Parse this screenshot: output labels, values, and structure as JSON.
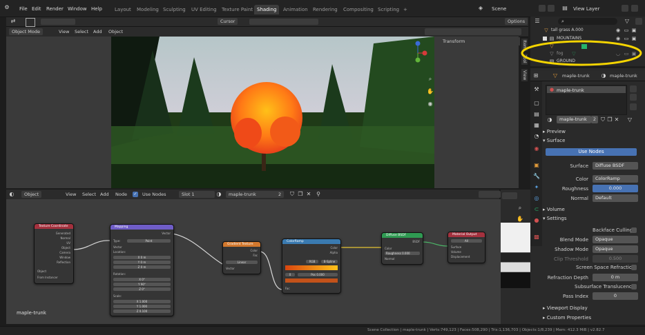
{
  "colors": {
    "accent": "#4772b3",
    "highlight_circle": "#f4d400",
    "node_input": "#a4313e",
    "node_vector": "#6f5dc7",
    "node_texture": "#d2782d",
    "node_converter": "#3a7ab0",
    "node_shader": "#2f9a52",
    "node_output": "#a4313e"
  },
  "topbar": {
    "menu": [
      "File",
      "Edit",
      "Render",
      "Window",
      "Help"
    ],
    "workspaces": [
      "Layout",
      "Modeling",
      "Sculpting",
      "UV Editing",
      "Texture Paint",
      "Shading",
      "Animation",
      "Rendering",
      "Compositing",
      "Scripting"
    ],
    "active_workspace": "Shading",
    "add_tab": "+",
    "scene": "Scene",
    "view_layer": "View Layer"
  },
  "viewport": {
    "mode": "Object Mode",
    "menus": [
      "View",
      "Select",
      "Add",
      "Object"
    ],
    "orientation": "Cursor",
    "options": "Options",
    "transform_panel": "Transform",
    "side_tabs": [
      "Item",
      "Tool",
      "View"
    ]
  },
  "outliner": {
    "search_placeholder": "",
    "items": [
      {
        "name": "tall grass A.000",
        "icon": "object-icon"
      },
      {
        "name": "MOUNTAINS",
        "icon": "collection-icon"
      },
      {
        "name": "",
        "icon": "object-icon"
      },
      {
        "name": "fog",
        "icon": "object-icon"
      },
      {
        "name": "GROUND",
        "icon": "collection-icon"
      }
    ]
  },
  "properties": {
    "object_name": "maple-trunk",
    "material_name": "maple-trunk",
    "slot_item": "maple-trunk",
    "users": "2",
    "sections": {
      "preview": "Preview",
      "surface": "Surface",
      "volume": "Volume",
      "settings": "Settings",
      "viewport_display": "Viewport Display",
      "custom_properties": "Custom Properties"
    },
    "use_nodes": "Use Nodes",
    "surface": {
      "label": "Surface",
      "value": "Diffuse BSDF"
    },
    "color": {
      "label": "Color",
      "value": "ColorRamp"
    },
    "roughness": {
      "label": "Roughness",
      "value": "0.000"
    },
    "normal": {
      "label": "Normal",
      "value": "Default"
    },
    "backface_culling": "Backface Culling",
    "blend_mode": {
      "label": "Blend Mode",
      "value": "Opaque"
    },
    "shadow_mode": {
      "label": "Shadow Mode",
      "value": "Opaque"
    },
    "clip_threshold": {
      "label": "Clip Threshold",
      "value": "0.500"
    },
    "screen_space_refraction": "Screen Space Refraction",
    "refraction_depth": {
      "label": "Refraction Depth",
      "value": "0 m"
    },
    "subsurface_translucency": "Subsurface Translucency",
    "pass_index": {
      "label": "Pass Index",
      "value": "0"
    }
  },
  "node_editor": {
    "type": "Object",
    "menus": [
      "View",
      "Select",
      "Add",
      "Node"
    ],
    "use_nodes": "Use Nodes",
    "slot": "Slot 1",
    "material": "maple-trunk",
    "users": "2",
    "label": "maple-trunk",
    "nodes": {
      "texcoord": {
        "title": "Texture Coordinate",
        "outputs": [
          "Generated",
          "Normal",
          "UV",
          "Object",
          "Camera",
          "Window",
          "Reflection"
        ],
        "object_label": "Object",
        "from_instancer": "From Instancer"
      },
      "mapping": {
        "title": "Mapping",
        "output": "Vector",
        "type_label": "Type:",
        "type_value": "Point",
        "vector": "Vector",
        "location": "Location:",
        "loc": [
          {
            "a": "X",
            "v": "0 m"
          },
          {
            "a": "Y",
            "v": "0 m"
          },
          {
            "a": "Z",
            "v": "0 m"
          }
        ],
        "rotation": "Rotation:",
        "rot": [
          {
            "a": "X",
            "v": "0°"
          },
          {
            "a": "Y",
            "v": "90°"
          },
          {
            "a": "Z",
            "v": "0°"
          }
        ],
        "scale": "Scale:",
        "scl": [
          {
            "a": "X",
            "v": "1.000"
          },
          {
            "a": "Y",
            "v": "1.000"
          },
          {
            "a": "Z",
            "v": "0.100"
          }
        ]
      },
      "gradient": {
        "title": "Gradient Texture",
        "outputs": [
          "Color",
          "Fac"
        ],
        "type": "Linear",
        "input": "Vector"
      },
      "colorramp": {
        "title": "ColorRamp",
        "outputs": [
          "Color",
          "Alpha"
        ],
        "mode": "RGB",
        "interp": "B-Spline",
        "index": "0",
        "pos_label": "Pos",
        "pos": "0.000",
        "input": "Fac"
      },
      "diffuse": {
        "title": "Diffuse BSDF",
        "output": "BSDF",
        "inputs": [
          "Color",
          "Roughness",
          "Normal"
        ],
        "roughness": "0.000"
      },
      "output": {
        "title": "Material Output",
        "target": "All",
        "inputs": [
          "Surface",
          "Volume",
          "Displacement"
        ]
      }
    }
  },
  "statusbar": {
    "text": "Scene Collection | maple-trunk | Verts:749,123 | Faces:508,290 | Tris:1,136,703 | Objects:1/8,239 | Mem: 412.3 MiB | v2.82.7"
  }
}
